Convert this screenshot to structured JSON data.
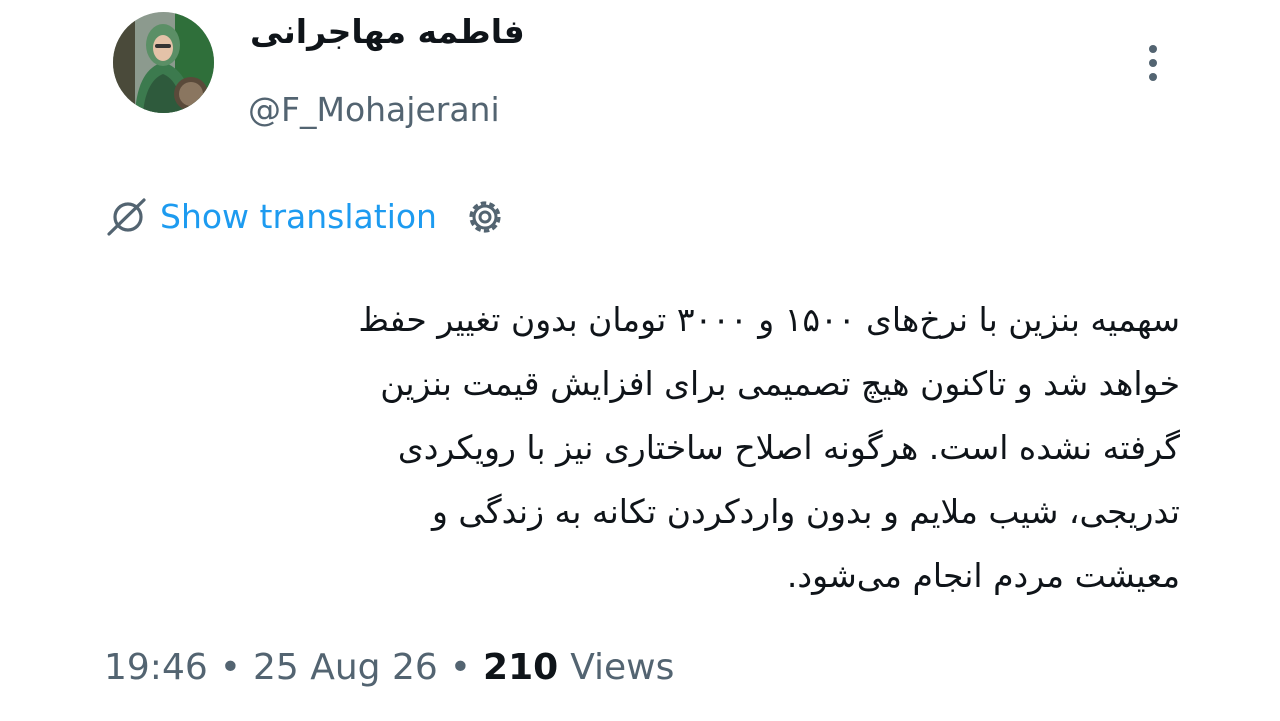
{
  "author": {
    "display_name": "فاطمه مهاجرانی",
    "handle": "@F_Mohajerani"
  },
  "icons": {
    "more": "more-vertical-icon",
    "translate": "translate-globe-icon",
    "settings": "gear-icon"
  },
  "translation": {
    "label": "Show translation"
  },
  "tweet": {
    "lines": [
      "سهمیه بنزین با نرخ‌های ۱۵۰۰ و ۳۰۰۰ تومان بدون تغییر حفظ",
      "خواهد شد و تاکنون هیچ تصمیمی برای افزایش قیمت بنزین",
      "گرفته نشده است. هرگونه اصلاح ساختاری نیز با رویکردی",
      "تدریجی، شیب ملایم و بدون واردکردن تکانه به زندگی و",
      "معیشت مردم انجام می‌شود."
    ]
  },
  "meta": {
    "time": "19:46",
    "separator": "•",
    "date": "25 Aug 26",
    "views_count": "210",
    "views_label": "Views"
  },
  "colors": {
    "link": "#1d9bf0",
    "text": "#0f1419",
    "secondary": "#536471"
  }
}
